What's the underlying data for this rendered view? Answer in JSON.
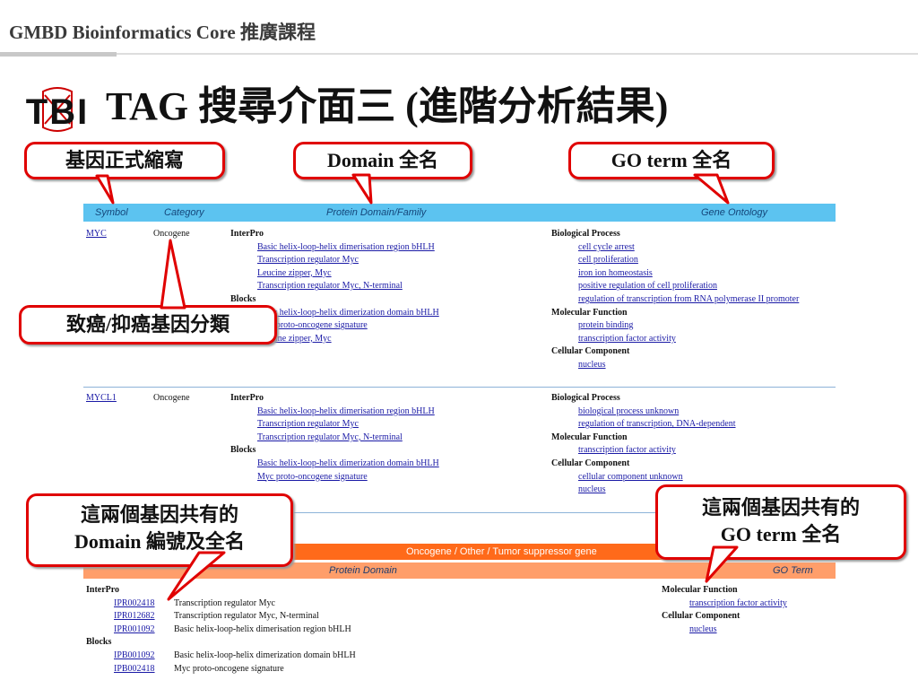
{
  "header": {
    "text": "GMBD Bioinformatics Core 推廣課程"
  },
  "logo": {
    "text": "TBI"
  },
  "title": "TAG 搜尋介面三 (進階分析結果)",
  "callouts": {
    "symbol": "基因正式縮寫",
    "domain": "Domain 全名",
    "go": "GO term 全名",
    "category": "致癌/抑癌基因分類",
    "shared_domain_line1": "這兩個基因共有的",
    "shared_domain_line2": "Domain 編號及全名",
    "shared_go_line1": "這兩個基因共有的",
    "shared_go_line2": "GO term 全名"
  },
  "table_header": {
    "symbol": "Symbol",
    "category": "Category",
    "domain": "Protein Domain/Family",
    "go": "Gene Ontology"
  },
  "rows": [
    {
      "symbol": "MYC",
      "category": "Oncogene",
      "interpro_label": "InterPro",
      "interpro": [
        "Basic helix-loop-helix dimerisation region bHLH",
        "Transcription regulator Myc",
        "Leucine zipper, Myc",
        "Transcription regulator Myc, N-terminal"
      ],
      "blocks_label": "Blocks",
      "blocks": [
        "Basic helix-loop-helix dimerization domain bHLH",
        "Myc proto-oncogene signature",
        "Leucine zipper, Myc"
      ],
      "bp_label": "Biological Process",
      "bp": [
        "cell cycle arrest",
        "cell proliferation",
        "iron ion homeostasis",
        "positive regulation of cell proliferation",
        "regulation of transcription from RNA polymerase II promoter"
      ],
      "mf_label": "Molecular Function",
      "mf": [
        "protein binding",
        "transcription factor activity"
      ],
      "cc_label": "Cellular Component",
      "cc": [
        "nucleus"
      ]
    },
    {
      "symbol": "MYCL1",
      "category": "Oncogene",
      "interpro_label": "InterPro",
      "interpro": [
        "Basic helix-loop-helix dimerisation region bHLH",
        "Transcription regulator Myc",
        "Transcription regulator Myc, N-terminal"
      ],
      "blocks_label": "Blocks",
      "blocks": [
        "Basic helix-loop-helix dimerization domain bHLH",
        "Myc proto-oncogene signature"
      ],
      "bp_label": "Biological Process",
      "bp": [
        "biological process unknown",
        "regulation of transcription, DNA-dependent"
      ],
      "mf_label": "Molecular Function",
      "mf": [
        "transcription factor activity"
      ],
      "cc_label": "Cellular Component",
      "cc": [
        "cellular component unknown",
        "nucleus"
      ]
    }
  ],
  "shared": {
    "band_title": "Oncogene / Other / Tumor suppressor gene",
    "domain_header": "Protein Domain",
    "go_header": "GO Term",
    "interpro_label": "InterPro",
    "interpro": [
      {
        "id": "IPR002418",
        "name": "Transcription regulator Myc"
      },
      {
        "id": "IPR012682",
        "name": "Transcription regulator Myc, N-terminal"
      },
      {
        "id": "IPR001092",
        "name": "Basic helix-loop-helix dimerisation region bHLH"
      }
    ],
    "blocks_label": "Blocks",
    "blocks": [
      {
        "id": "IPB001092",
        "name": "Basic helix-loop-helix dimerization domain bHLH"
      },
      {
        "id": "IPB002418",
        "name": "Myc proto-oncogene signature"
      }
    ],
    "mf_label": "Molecular Function",
    "mf": [
      "transcription factor activity"
    ],
    "cc_label": "Cellular Component",
    "cc": [
      "nucleus"
    ]
  },
  "colors": {
    "accent_blue": "#5cc3f0",
    "orange": "#ff6a1a",
    "light_orange": "#ff9e6a",
    "callout_border": "#e00000",
    "link": "#1a1aa6"
  }
}
